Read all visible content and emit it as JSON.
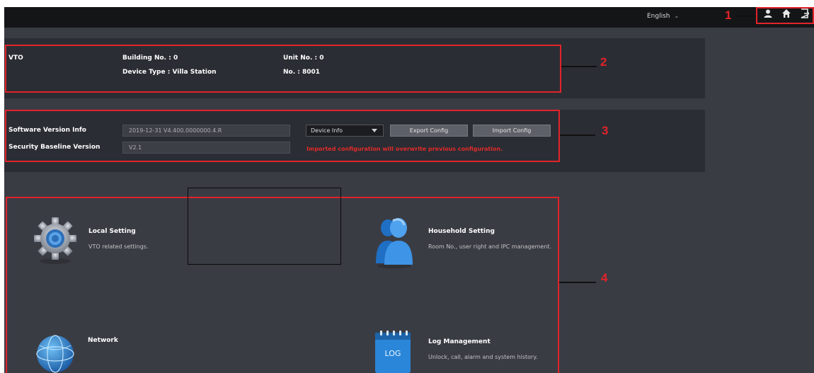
{
  "header": {
    "language": "English",
    "icons": [
      "user-icon",
      "home-icon",
      "logout-icon"
    ]
  },
  "callouts": [
    "1",
    "2",
    "3",
    "4"
  ],
  "device": {
    "name": "VTO",
    "building_label": "Building No. : 0",
    "device_type_label": "Device Type : Villa Station",
    "unit_label": "Unit No. : 0",
    "number_label": "No. : 8001"
  },
  "version": {
    "software_label": "Software Version Info",
    "software_value": "2019-12-31 V4.400.0000000.4.R",
    "baseline_label": "Security Baseline Version",
    "baseline_value": "V2.1",
    "select_value": "Device Info",
    "export_button": "Export Config",
    "import_button": "Import Config",
    "warning": "Imported configuration will overwrite previous configuration."
  },
  "modules": [
    {
      "title": "Local Setting",
      "desc": "VTO related settings.",
      "icon": "gear-icon"
    },
    {
      "title": "Household Setting",
      "desc": "Room No., user right and IPC management.",
      "icon": "user-silhouette-icon"
    },
    {
      "title": "Network",
      "desc": "",
      "icon": "globe-icon"
    },
    {
      "title": "Log Management",
      "desc": "Unlock, call, alarm and system history.",
      "icon": "log-icon",
      "icon_text": "LOG"
    }
  ],
  "colors": {
    "callout_red": "#e1232a",
    "panel": "#2b2d34",
    "background": "#3a3c44",
    "topbar": "#141517"
  }
}
